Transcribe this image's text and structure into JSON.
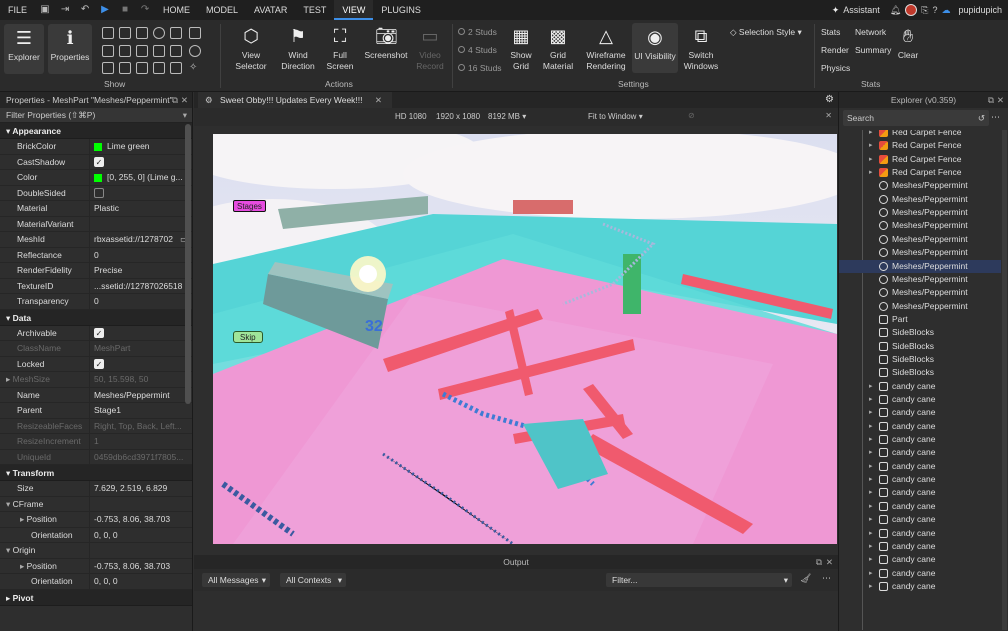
{
  "menu": {
    "file": "FILE",
    "tabs": [
      "HOME",
      "MODEL",
      "AVATAR",
      "TEST",
      "VIEW",
      "PLUGINS"
    ],
    "active": "VIEW",
    "assistant": "Assistant",
    "user": "pupidupich"
  },
  "ribbon": {
    "explorer": "Explorer",
    "properties": "Properties",
    "show_group": "Show",
    "view_selector": "View Selector",
    "wind_direction": "Wind Direction",
    "full_screen": "Full Screen",
    "screenshot": "Screenshot",
    "video_record": "Video Record",
    "actions_group": "Actions",
    "studs2": "2 Studs",
    "studs4": "4 Studs",
    "studs16": "16 Studs",
    "show_grid": "Show Grid",
    "grid_material": "Grid Material",
    "wireframe": "Wireframe Rendering",
    "ui_visibility": "UI Visibility",
    "switch_windows": "Switch Windows",
    "settings_group": "Settings",
    "selection_style": "Selection Style",
    "stats": "Stats",
    "network": "Network",
    "render": "Render",
    "summary": "Summary",
    "physics": "Physics",
    "clear": "Clear",
    "stats_group": "Stats"
  },
  "properties": {
    "title": "Properties - MeshPart \"Meshes/Peppermint\"",
    "filter": "Filter Properties (⇧⌘P)",
    "appearance": "Appearance",
    "rows_appearance": [
      {
        "n": "BrickColor",
        "v": "Lime green"
      },
      {
        "n": "CastShadow",
        "v": ""
      },
      {
        "n": "Color",
        "v": "[0, 255, 0] (Lime g..."
      },
      {
        "n": "DoubleSided",
        "v": ""
      },
      {
        "n": "Material",
        "v": "Plastic"
      },
      {
        "n": "MaterialVariant",
        "v": ""
      },
      {
        "n": "MeshId",
        "v": "rbxassetid://1278702"
      },
      {
        "n": "Reflectance",
        "v": "0"
      },
      {
        "n": "RenderFidelity",
        "v": "Precise"
      },
      {
        "n": "TextureID",
        "v": "...ssetid://12787026518"
      },
      {
        "n": "Transparency",
        "v": "0"
      }
    ],
    "data": "Data",
    "rows_data": [
      {
        "n": "Archivable",
        "v": ""
      },
      {
        "n": "ClassName",
        "v": "MeshPart"
      },
      {
        "n": "Locked",
        "v": ""
      },
      {
        "n": "MeshSize",
        "v": "50, 15.598, 50"
      },
      {
        "n": "Name",
        "v": "Meshes/Peppermint"
      },
      {
        "n": "Parent",
        "v": "Stage1"
      },
      {
        "n": "ResizeableFaces",
        "v": "Right, Top, Back, Left..."
      },
      {
        "n": "ResizeIncrement",
        "v": "1"
      },
      {
        "n": "UniqueId",
        "v": "0459db6cd3971f7805..."
      }
    ],
    "transform": "Transform",
    "rows_transform": [
      {
        "n": "Size",
        "v": "7.629, 2.519, 6.829"
      },
      {
        "n": "CFrame",
        "v": ""
      },
      {
        "n": "Position",
        "v": "-0.753, 8.06, 38.703"
      },
      {
        "n": "Orientation",
        "v": "0, 0, 0"
      },
      {
        "n": "Origin",
        "v": ""
      },
      {
        "n": "Position",
        "v": "-0.753, 8.06, 38.703"
      },
      {
        "n": "Orientation",
        "v": "0, 0, 0"
      }
    ],
    "pivot": "Pivot"
  },
  "center": {
    "tab": "Sweet Obby!!! Updates Every Week!!!",
    "hd": "HD 1080",
    "res": "1920 x 1080",
    "mem": "8192 MB",
    "fit": "Fit to Window",
    "stages_label": "Stages",
    "skip_label": "Skip",
    "score": "32",
    "output_title": "Output",
    "all_messages": "All Messages",
    "all_contexts": "All Contexts",
    "filter_placeholder": "Filter..."
  },
  "explorer": {
    "title": "Explorer (v0.359)",
    "search": "Search",
    "items": [
      {
        "label": "Red Carpet Fence",
        "icon": "model",
        "arrow": true
      },
      {
        "label": "Red Carpet Fence",
        "icon": "model",
        "arrow": true
      },
      {
        "label": "Red Carpet Fence",
        "icon": "model",
        "arrow": true
      },
      {
        "label": "Red Carpet Fence",
        "icon": "model",
        "arrow": true
      },
      {
        "label": "Meshes/Peppermint",
        "icon": "mesh",
        "arrow": false
      },
      {
        "label": "Meshes/Peppermint",
        "icon": "mesh",
        "arrow": false
      },
      {
        "label": "Meshes/Peppermint",
        "icon": "mesh",
        "arrow": false
      },
      {
        "label": "Meshes/Peppermint",
        "icon": "mesh",
        "arrow": false
      },
      {
        "label": "Meshes/Peppermint",
        "icon": "mesh",
        "arrow": false
      },
      {
        "label": "Meshes/Peppermint",
        "icon": "mesh",
        "arrow": false
      },
      {
        "label": "Meshes/Peppermint",
        "icon": "mesh",
        "arrow": false,
        "selected": true
      },
      {
        "label": "Meshes/Peppermint",
        "icon": "mesh",
        "arrow": false
      },
      {
        "label": "Meshes/Peppermint",
        "icon": "mesh",
        "arrow": false
      },
      {
        "label": "Meshes/Peppermint",
        "icon": "mesh",
        "arrow": false
      },
      {
        "label": "Part",
        "icon": "part",
        "arrow": false
      },
      {
        "label": "SideBlocks",
        "icon": "part",
        "arrow": false
      },
      {
        "label": "SideBlocks",
        "icon": "part",
        "arrow": false
      },
      {
        "label": "SideBlocks",
        "icon": "part",
        "arrow": false
      },
      {
        "label": "SideBlocks",
        "icon": "part",
        "arrow": false
      },
      {
        "label": "candy cane",
        "icon": "part",
        "arrow": true
      },
      {
        "label": "candy cane",
        "icon": "part",
        "arrow": true
      },
      {
        "label": "candy cane",
        "icon": "part",
        "arrow": true
      },
      {
        "label": "candy cane",
        "icon": "part",
        "arrow": true
      },
      {
        "label": "candy cane",
        "icon": "part",
        "arrow": true
      },
      {
        "label": "candy cane",
        "icon": "part",
        "arrow": true
      },
      {
        "label": "candy cane",
        "icon": "part",
        "arrow": true
      },
      {
        "label": "candy cane",
        "icon": "part",
        "arrow": true
      },
      {
        "label": "candy cane",
        "icon": "part",
        "arrow": true
      },
      {
        "label": "candy cane",
        "icon": "part",
        "arrow": true
      },
      {
        "label": "candy cane",
        "icon": "part",
        "arrow": true
      },
      {
        "label": "candy cane",
        "icon": "part",
        "arrow": true
      },
      {
        "label": "candy cane",
        "icon": "part",
        "arrow": true
      },
      {
        "label": "candy cane",
        "icon": "part",
        "arrow": true
      },
      {
        "label": "candy cane",
        "icon": "part",
        "arrow": true
      },
      {
        "label": "candy cane",
        "icon": "part",
        "arrow": true
      }
    ]
  }
}
